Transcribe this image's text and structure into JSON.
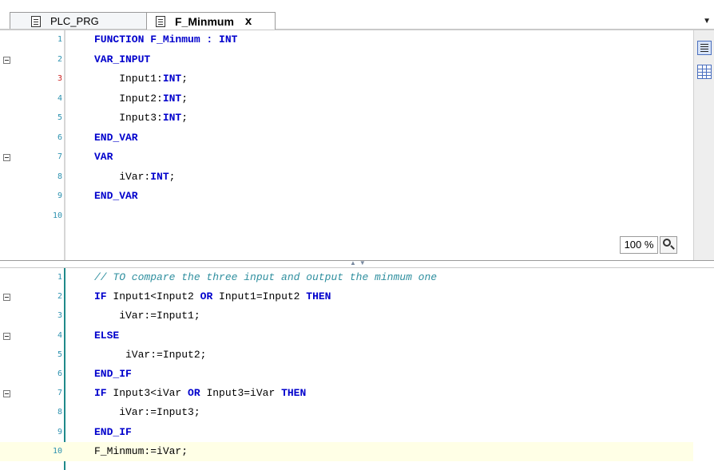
{
  "tabs": [
    {
      "label": "PLC_PRG",
      "active": false
    },
    {
      "label": "F_Minmum",
      "active": true,
      "close": "x"
    }
  ],
  "declaration": {
    "lines": [
      {
        "num": "1",
        "tokens": [
          {
            "t": "FUNCTION F_Minmum : ",
            "k": "kw"
          },
          {
            "t": "INT",
            "k": "kw"
          }
        ]
      },
      {
        "num": "2",
        "fold": true,
        "tokens": [
          {
            "t": "VAR_INPUT",
            "k": "kw"
          }
        ]
      },
      {
        "num": "3",
        "err": true,
        "tokens": [
          {
            "t": "    Input1:",
            "k": ""
          },
          {
            "t": "INT",
            "k": "kw"
          },
          {
            "t": ";",
            "k": ""
          }
        ]
      },
      {
        "num": "4",
        "tokens": [
          {
            "t": "    Input2:",
            "k": ""
          },
          {
            "t": "INT",
            "k": "kw"
          },
          {
            "t": ";",
            "k": ""
          }
        ]
      },
      {
        "num": "5",
        "tokens": [
          {
            "t": "    Input3:",
            "k": ""
          },
          {
            "t": "INT",
            "k": "kw"
          },
          {
            "t": ";",
            "k": ""
          }
        ]
      },
      {
        "num": "6",
        "tokens": [
          {
            "t": "END_VAR",
            "k": "kw"
          }
        ]
      },
      {
        "num": "7",
        "fold": true,
        "tokens": [
          {
            "t": "VAR",
            "k": "kw"
          }
        ]
      },
      {
        "num": "8",
        "tokens": [
          {
            "t": "    iVar:",
            "k": ""
          },
          {
            "t": "INT",
            "k": "kw"
          },
          {
            "t": ";",
            "k": ""
          }
        ]
      },
      {
        "num": "9",
        "tokens": [
          {
            "t": "END_VAR",
            "k": "kw"
          }
        ]
      },
      {
        "num": "10",
        "tokens": [
          {
            "t": "",
            "k": ""
          }
        ]
      }
    ]
  },
  "zoom": {
    "value": "100 %"
  },
  "implementation": {
    "lines": [
      {
        "num": "1",
        "tokens": [
          {
            "t": "// TO compare the three input and output the minmum one",
            "k": "cm"
          }
        ]
      },
      {
        "num": "2",
        "fold": true,
        "tokens": [
          {
            "t": "IF",
            "k": "kw"
          },
          {
            "t": " Input1<Input2 ",
            "k": ""
          },
          {
            "t": "OR",
            "k": "kw"
          },
          {
            "t": " Input1=Input2 ",
            "k": ""
          },
          {
            "t": "THEN",
            "k": "kw"
          }
        ]
      },
      {
        "num": "3",
        "tokens": [
          {
            "t": "    iVar:=Input1;",
            "k": ""
          }
        ]
      },
      {
        "num": "4",
        "fold": true,
        "tokens": [
          {
            "t": "ELSE",
            "k": "kw"
          }
        ]
      },
      {
        "num": "5",
        "tokens": [
          {
            "t": "     iVar:=Input2;",
            "k": ""
          }
        ]
      },
      {
        "num": "6",
        "tokens": [
          {
            "t": "END_IF",
            "k": "kw"
          }
        ]
      },
      {
        "num": "7",
        "fold": true,
        "tokens": [
          {
            "t": "IF",
            "k": "kw"
          },
          {
            "t": " Input3<iVar ",
            "k": ""
          },
          {
            "t": "OR",
            "k": "kw"
          },
          {
            "t": " Input3=iVar ",
            "k": ""
          },
          {
            "t": "THEN",
            "k": "kw"
          }
        ]
      },
      {
        "num": "8",
        "tokens": [
          {
            "t": "    iVar:=Input3;",
            "k": ""
          }
        ]
      },
      {
        "num": "9",
        "tokens": [
          {
            "t": "END_IF",
            "k": "kw"
          }
        ]
      },
      {
        "num": "10",
        "highlight": true,
        "tokens": [
          {
            "t": "F_Minmum:=iVar;",
            "k": ""
          }
        ]
      }
    ]
  },
  "colors": {
    "keyword": "#0000cc",
    "comment": "#2f8f9f",
    "line_number": "#2b91af",
    "current_line": "#ffffe6"
  },
  "icons": [
    "document-icon",
    "close-icon",
    "dropdown-arrow-icon",
    "declaration-view-icon",
    "table-view-icon",
    "zoom-icon",
    "fold-minus-icon",
    "splitter-arrows-icon"
  ]
}
